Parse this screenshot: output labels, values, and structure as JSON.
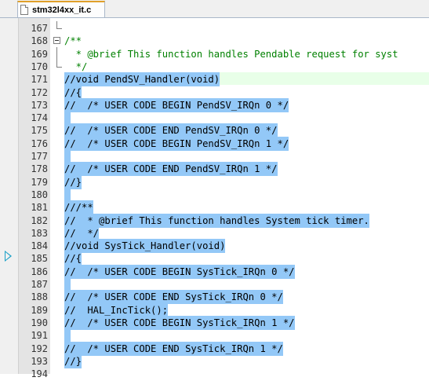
{
  "tab": {
    "filename": "stm32l4xx_it.c"
  },
  "lines": [
    {
      "num": "167",
      "text": "",
      "kind": "plain",
      "fold": "end"
    },
    {
      "num": "168",
      "text": "/**",
      "kind": "comment",
      "fold": "open"
    },
    {
      "num": "169",
      "text": "  * @brief This function handles Pendable request for syst",
      "kind": "comment",
      "fold": "line"
    },
    {
      "num": "170",
      "text": "  */",
      "kind": "comment",
      "fold": "end"
    },
    {
      "num": "171",
      "text": "//void PendSV_Handler(void)",
      "kind": "sel",
      "current": true
    },
    {
      "num": "172",
      "text": "//{",
      "kind": "sel"
    },
    {
      "num": "173",
      "text": "//  /* USER CODE BEGIN PendSV_IRQn 0 */",
      "kind": "sel"
    },
    {
      "num": "174",
      "text": "  ",
      "kind": "sel"
    },
    {
      "num": "175",
      "text": "//  /* USER CODE END PendSV_IRQn 0 */",
      "kind": "sel"
    },
    {
      "num": "176",
      "text": "//  /* USER CODE BEGIN PendSV_IRQn 1 */",
      "kind": "sel"
    },
    {
      "num": "177",
      "text": "  ",
      "kind": "sel"
    },
    {
      "num": "178",
      "text": "//  /* USER CODE END PendSV_IRQn 1 */",
      "kind": "sel"
    },
    {
      "num": "179",
      "text": "//}",
      "kind": "sel"
    },
    {
      "num": "180",
      "text": "  ",
      "kind": "sel"
    },
    {
      "num": "181",
      "text": "///**",
      "kind": "sel"
    },
    {
      "num": "182",
      "text": "//  * @brief This function handles System tick timer.",
      "kind": "sel"
    },
    {
      "num": "183",
      "text": "//  */",
      "kind": "sel"
    },
    {
      "num": "184",
      "text": "//void SysTick_Handler(void)",
      "kind": "sel"
    },
    {
      "num": "185",
      "text": "//{",
      "kind": "sel"
    },
    {
      "num": "186",
      "text": "//  /* USER CODE BEGIN SysTick_IRQn 0 */",
      "kind": "sel"
    },
    {
      "num": "187",
      "text": "  ",
      "kind": "sel"
    },
    {
      "num": "188",
      "text": "//  /* USER CODE END SysTick_IRQn 0 */",
      "kind": "sel"
    },
    {
      "num": "189",
      "text": "//  HAL_IncTick();",
      "kind": "sel"
    },
    {
      "num": "190",
      "text": "//  /* USER CODE BEGIN SysTick_IRQn 1 */",
      "kind": "sel"
    },
    {
      "num": "191",
      "text": "  ",
      "kind": "sel"
    },
    {
      "num": "192",
      "text": "//  /* USER CODE END SysTick_IRQn 1 */",
      "kind": "sel"
    },
    {
      "num": "193",
      "text": "//}",
      "kind": "sel"
    },
    {
      "num": "194",
      "text": "",
      "kind": "plain"
    }
  ],
  "colors": {
    "selection": "#93c8f7",
    "comment": "#008000",
    "tab_accent": "#e0a02a",
    "marker": "#1aa0c8"
  },
  "icons": {
    "tab": "c-file-icon",
    "marker": "current-line-arrow-icon"
  }
}
